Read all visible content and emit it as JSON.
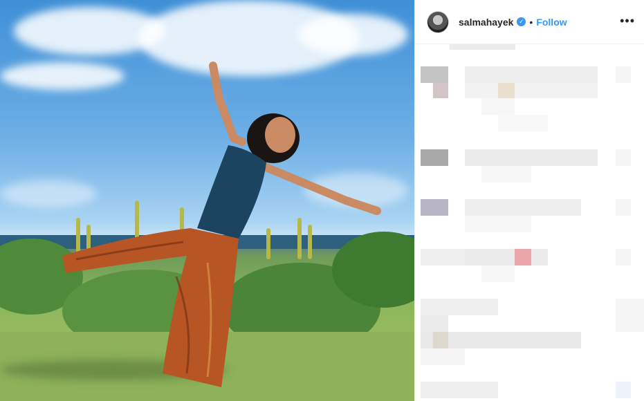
{
  "post": {
    "username": "salmahayek",
    "verified_icon": "✓",
    "separator": "•",
    "follow_label": "Follow",
    "more_label": "•••"
  },
  "colors": {
    "accent": "#3897f0",
    "text": "#262626",
    "border": "#efefef"
  }
}
